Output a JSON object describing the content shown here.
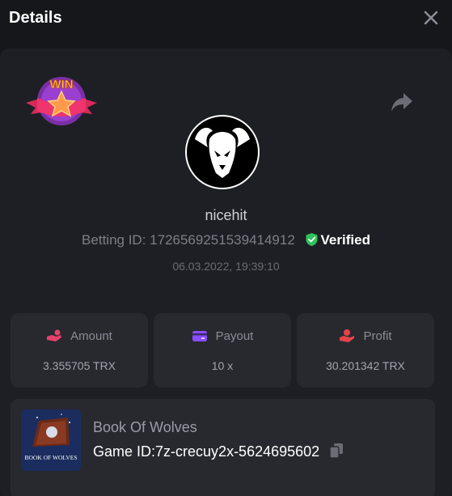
{
  "header": {
    "title": "Details"
  },
  "badge": {
    "text": "WIN"
  },
  "user": {
    "name": "nicehit",
    "betting_id_label": "Betting ID:",
    "betting_id": "1726569251539414912",
    "verified_label": "Verified",
    "timestamp": "06.03.2022, 19:39:10"
  },
  "stats": {
    "amount": {
      "label": "Amount",
      "value": "3.355705 TRX"
    },
    "payout": {
      "label": "Payout",
      "value": "10 x"
    },
    "profit": {
      "label": "Profit",
      "value": "30.201342 TRX"
    }
  },
  "game": {
    "name": "Book Of Wolves",
    "id_label": "Game ID:",
    "id": "7z-crecuy2x-5624695602",
    "thumb_text": "BOOK OF WOLVES"
  },
  "colors": {
    "amount_icon": "#e8426a",
    "payout_icon": "#8a4dff",
    "profit_icon": "#e8434a",
    "verified": "#2fc25b"
  }
}
